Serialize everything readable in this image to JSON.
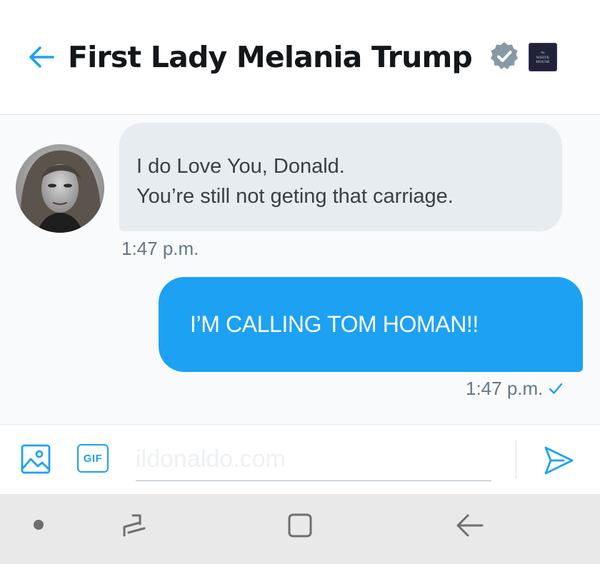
{
  "header": {
    "title": "First Lady Melania Trump",
    "badge_text": [
      "The",
      "WHITE",
      "HOUSE"
    ],
    "back_icon": "arrow-left-icon",
    "verified_icon": "verified-badge-icon"
  },
  "messages": [
    {
      "direction": "incoming",
      "lines": [
        "I do Love You, Donald.",
        "You’re still not geting that carriage."
      ],
      "time": "1:47 p.m."
    },
    {
      "direction": "outgoing",
      "text": "I’M CALLING TOM HOMAN!!",
      "time": "1:47 p.m.",
      "read_icon": "checkmark-icon"
    }
  ],
  "composer": {
    "image_icon": "image-icon",
    "gif_label": "GIF",
    "placeholder": "ildonaldo.com",
    "send_icon": "send-icon"
  },
  "colors": {
    "accent": "#1da1f2",
    "incoming_bubble": "#e6ecf0",
    "chat_background": "#f9fafb",
    "timestamp": "#657786"
  }
}
